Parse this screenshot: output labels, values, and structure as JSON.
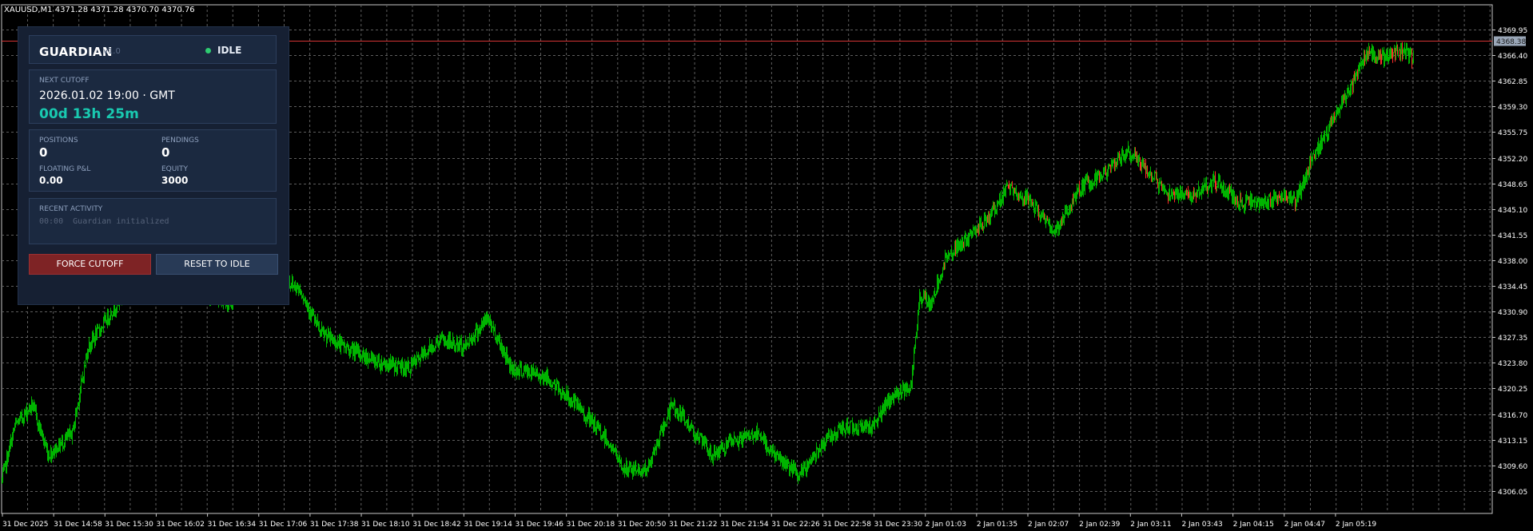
{
  "chart": {
    "symbol_line": "XAUUSD,M1  4371.28 4371.28 4370.70 4370.76",
    "current_price_label": "4368.38",
    "price_ticks": [
      "4369.95",
      "4366.40",
      "4362.85",
      "4359.30",
      "4355.75",
      "4352.20",
      "4348.65",
      "4345.10",
      "4341.55",
      "4338.00",
      "4334.45",
      "4330.90",
      "4327.35",
      "4323.80",
      "4320.25",
      "4316.70",
      "4313.15",
      "4309.60",
      "4306.05"
    ],
    "time_ticks": [
      "31 Dec 2025",
      "31 Dec 14:58",
      "31 Dec 15:30",
      "31 Dec 16:02",
      "31 Dec 16:34",
      "31 Dec 17:06",
      "31 Dec 17:38",
      "31 Dec 18:10",
      "31 Dec 18:42",
      "31 Dec 19:14",
      "31 Dec 19:46",
      "31 Dec 20:18",
      "31 Dec 20:50",
      "31 Dec 21:22",
      "31 Dec 21:54",
      "31 Dec 22:26",
      "31 Dec 22:58",
      "31 Dec 23:30",
      "2 Jan 01:03",
      "2 Jan 01:35",
      "2 Jan 02:07",
      "2 Jan 02:39",
      "2 Jan 03:11",
      "2 Jan 03:43",
      "2 Jan 04:15",
      "2 Jan 04:47",
      "2 Jan 05:19"
    ],
    "colors": {
      "background": "#000000",
      "grid": "#5e5e5e",
      "bull": "#00b400",
      "bear": "#ff2a2a",
      "price_line": "#d43434"
    }
  },
  "guardian": {
    "title": "GUARDIAN",
    "version": "v1.0",
    "status": "IDLE",
    "status_color": "#2ecc71",
    "next_cutoff_label": "NEXT CUTOFF",
    "next_cutoff_datetime": "2026.01.02 19:00 · GMT",
    "countdown": "00d 13h 25m",
    "positions_label": "POSITIONS",
    "positions_value": "0",
    "pendings_label": "PENDINGS",
    "pendings_value": "0",
    "floating_pl_label": "FLOATING P&L",
    "floating_pl_value": "0.00",
    "equity_label": "EQUITY",
    "equity_value": "3000",
    "recent_activity_label": "RECENT ACTIVITY",
    "activity_entries": [
      {
        "time": "00:00",
        "message": "Guardian initialized"
      }
    ],
    "force_cutoff_label": "FORCE CUTOFF",
    "reset_label": "RESET TO IDLE"
  }
}
